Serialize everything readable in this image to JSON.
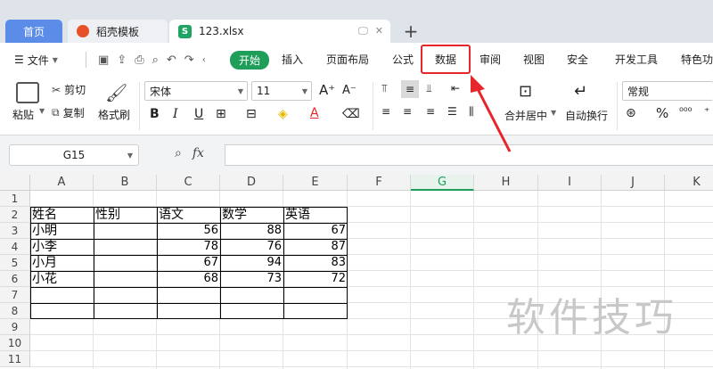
{
  "tabs": {
    "home": "首页",
    "template": "稻壳模板",
    "file": "123.xlsx",
    "file_icon_text": "S",
    "new_tab": "+"
  },
  "menu": {
    "file": "文件",
    "start": "开始",
    "insert": "插入",
    "layout": "页面布局",
    "formula": "公式",
    "data": "数据",
    "review": "审阅",
    "view": "视图",
    "security": "安全",
    "devtools": "开发工具",
    "special": "特色功"
  },
  "ribbon": {
    "paste": "粘贴",
    "cut": "剪切",
    "copy": "复制",
    "format_painter": "格式刷",
    "font_name": "宋体",
    "font_size": "11",
    "bold": "B",
    "italic": "I",
    "underline": "U",
    "merge_center": "合并居中",
    "wrap_text": "自动换行",
    "number_format": "常规",
    "percent": "%"
  },
  "formula_bar": {
    "name_box": "G15",
    "fx": "fx",
    "value": ""
  },
  "columns": [
    "A",
    "B",
    "C",
    "D",
    "E",
    "F",
    "G",
    "H",
    "I",
    "J",
    "K"
  ],
  "active_column": "G",
  "rows": [
    "1",
    "2",
    "3",
    "4",
    "5",
    "6",
    "7",
    "8",
    "9",
    "10",
    "11"
  ],
  "table": {
    "headers": [
      "姓名",
      "性别",
      "语文",
      "数学",
      "英语"
    ],
    "data": [
      {
        "name": "小明",
        "gender": "",
        "chinese": "56",
        "math": "88",
        "english": "67"
      },
      {
        "name": "小李",
        "gender": "",
        "chinese": "78",
        "math": "76",
        "english": "87"
      },
      {
        "name": "小月",
        "gender": "",
        "chinese": "67",
        "math": "94",
        "english": "83"
      },
      {
        "name": "小花",
        "gender": "",
        "chinese": "68",
        "math": "73",
        "english": "72"
      }
    ]
  },
  "watermark": "软件技巧",
  "colors": {
    "accent_green": "#1f9e5a",
    "highlight_red": "#e6262a",
    "home_tab_blue": "#5b8de8"
  }
}
